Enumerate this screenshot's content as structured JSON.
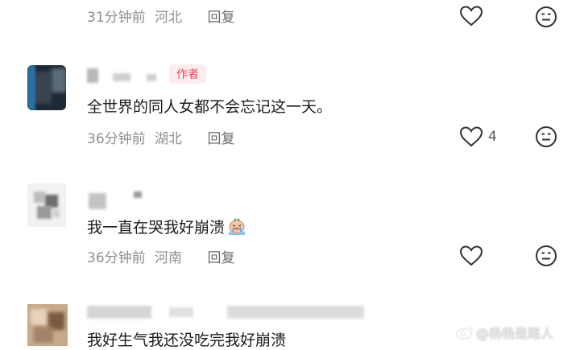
{
  "comments": [
    {
      "time": "31分钟前",
      "location": "河北",
      "reply_label": "回复",
      "likes": ""
    },
    {
      "author_badge": "作者",
      "text": "全世界的同人女都不会忘记这一天。",
      "time": "36分钟前",
      "location": "湖北",
      "reply_label": "回复",
      "likes": "4"
    },
    {
      "text": "我一直在哭我好崩溃",
      "time": "36分钟前",
      "location": "河南",
      "reply_label": "回复",
      "likes": ""
    },
    {
      "text": "我好生气我还没吃完我好崩溃"
    }
  ],
  "watermark": "@杨杨是路人",
  "icons": {
    "like": "heart-outline-icon",
    "dislike": "neutral-face-icon",
    "emoji": "crying-emoji"
  },
  "colors": {
    "author_badge_text": "#e24a5c",
    "author_badge_bg": "#fdecee",
    "meta_text": "#8e8e8e"
  }
}
